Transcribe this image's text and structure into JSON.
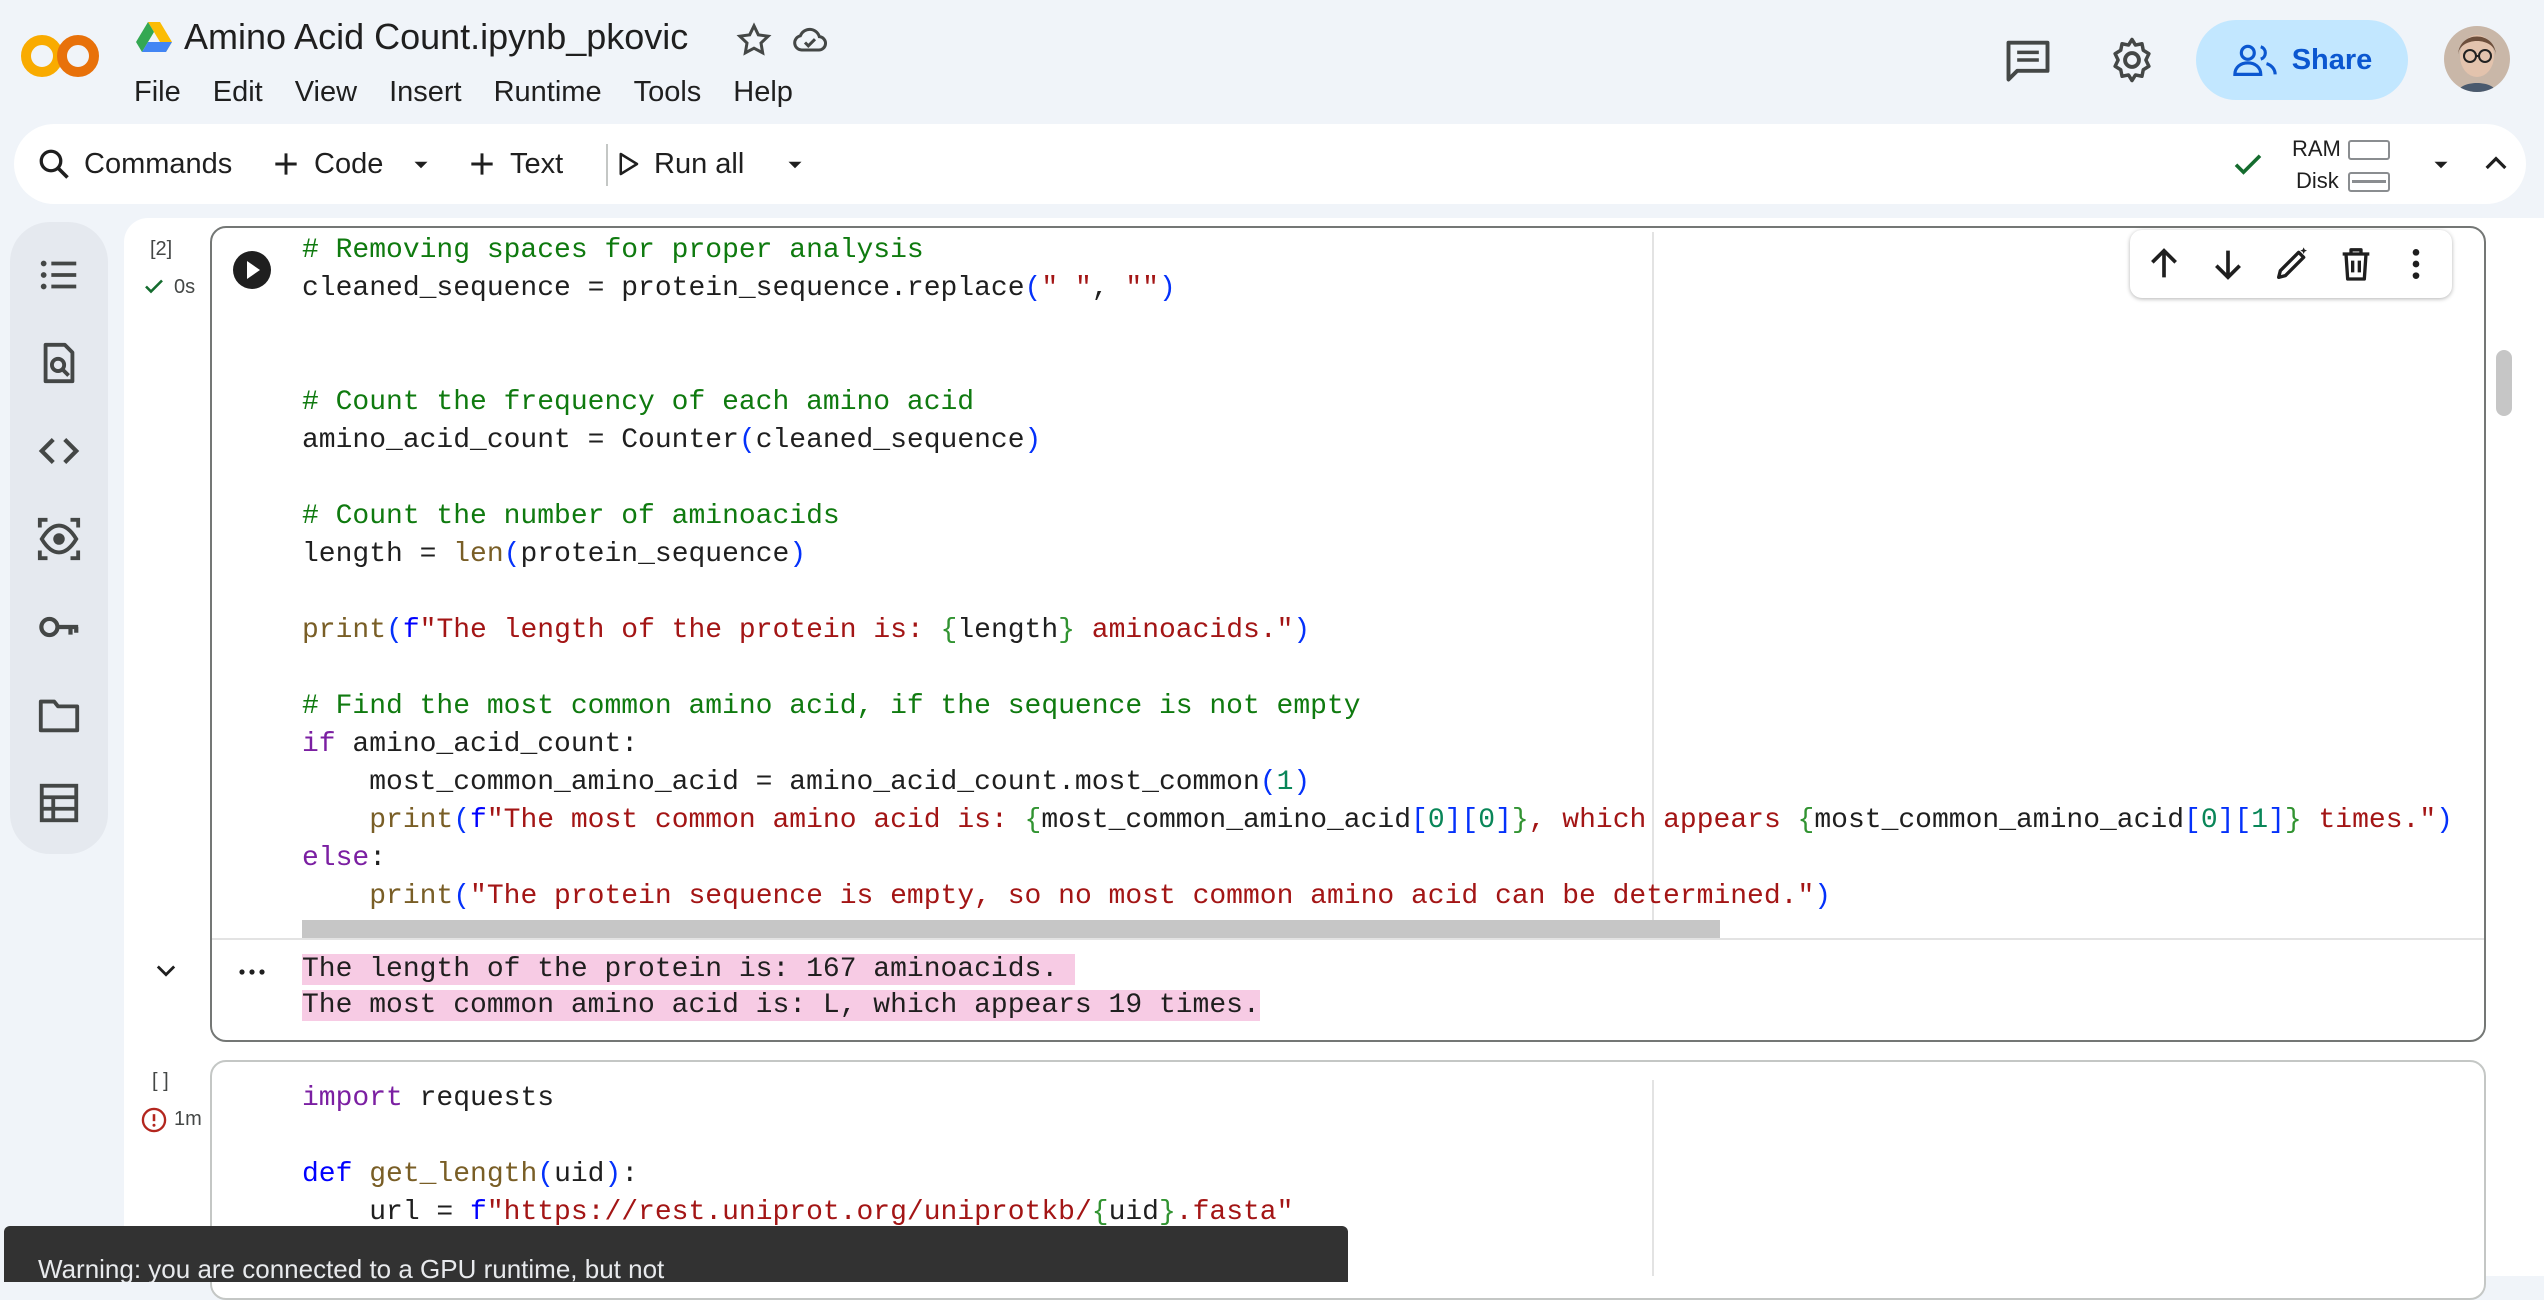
{
  "header": {
    "notebook_title": "Amino Acid Count.ipynb_pkovic",
    "menu": [
      "File",
      "Edit",
      "View",
      "Insert",
      "Runtime",
      "Tools",
      "Help"
    ],
    "share_label": "Share"
  },
  "toolbar": {
    "commands_label": "Commands",
    "code_label": "Code",
    "text_label": "Text",
    "run_all_label": "Run all",
    "ram_label": "RAM",
    "disk_label": "Disk"
  },
  "sidebar": {
    "icons": [
      "table-of-contents-icon",
      "find-replace-icon",
      "code-snippets-icon",
      "variables-icon",
      "secrets-key-icon",
      "files-folder-icon",
      "data-table-icon"
    ]
  },
  "cells": [
    {
      "execution_count": "[2]",
      "duration": "0s",
      "status": "success",
      "output_lines": [
        "The length of the protein is: 167 aminoacids. ",
        "The most common amino acid is: L, which appears 19 times."
      ]
    },
    {
      "execution_count": "[ ]",
      "duration": "1m",
      "status": "error"
    }
  ],
  "toast": {
    "message": "Warning: you are connected to a GPU runtime, but not"
  },
  "colors": {
    "accent": "#0b57d0",
    "share_bg": "#c2e7ff",
    "output_highlight": "#f7cbe4",
    "success": "#146c2e",
    "error": "#b3261e"
  }
}
